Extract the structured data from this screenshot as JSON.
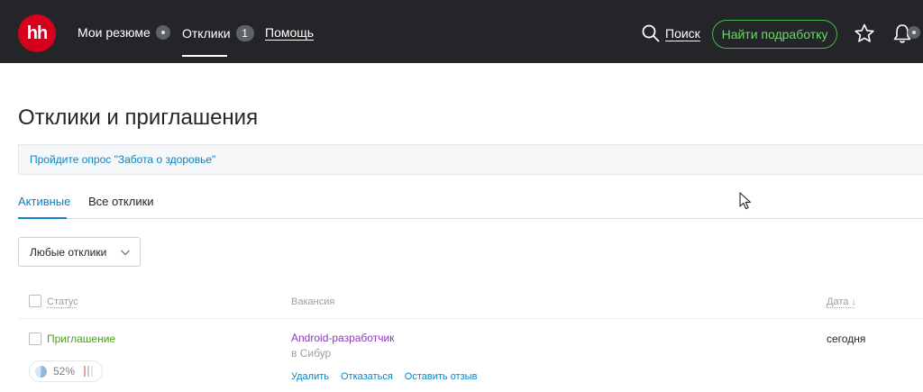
{
  "header": {
    "logo": "hh",
    "nav": {
      "resume_label": "Мои резюме",
      "responses_label": "Отклики",
      "responses_count": "1",
      "help_label": "Помощь"
    },
    "search_label": "Поиск",
    "find_job_label": "Найти подработку",
    "icons": [
      "search-icon",
      "star-icon",
      "bell-icon"
    ]
  },
  "page": {
    "title": "Отклики и приглашения",
    "survey_link": "Пройдите опрос \"Забота о здоровье\""
  },
  "tabs": [
    {
      "label": "Активные",
      "active": true
    },
    {
      "label": "Все отклики",
      "active": false
    }
  ],
  "filter": {
    "selected": "Любые отклики"
  },
  "table": {
    "columns": {
      "status": "Статус",
      "vacancy": "Вакансия",
      "date": "Дата ↓"
    },
    "rows": [
      {
        "status": "Приглашение",
        "progress": "52%",
        "progress_value": 0.52,
        "vacancy": "Android-разработчик",
        "employer": "в Сибур",
        "date": "сегодня",
        "actions": [
          "Удалить",
          "Отказаться",
          "Оставить отзыв"
        ]
      }
    ]
  },
  "colors": {
    "topbar": "#232529",
    "brand": "#d6001c",
    "accent_link": "#0a84c2",
    "invite_status": "#4c9f1f",
    "vacancy_link": "#8a3ab9",
    "find_job_border": "#4bb34b"
  }
}
